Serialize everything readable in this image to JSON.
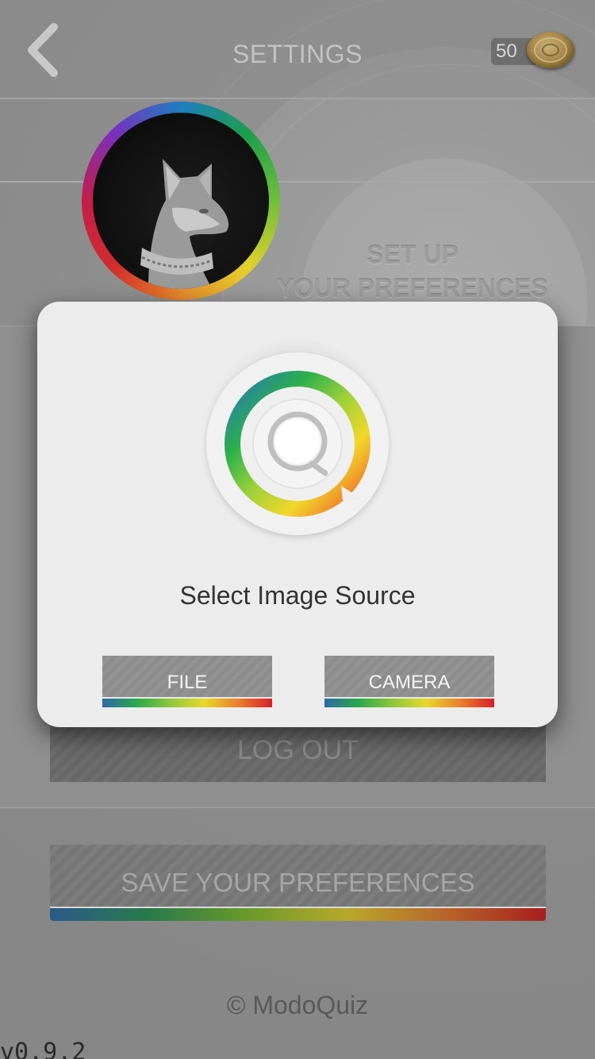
{
  "header": {
    "title": "SETTINGS",
    "coins": "50"
  },
  "profile": {
    "heading_line1": "SET UP",
    "heading_line2": "YOUR PREFERENCES"
  },
  "buttons": {
    "logout": "LOG OUT",
    "save": "SAVE YOUR PREFERENCES"
  },
  "footer": {
    "copyright": "© ModoQuiz",
    "version": "v0.9.2"
  },
  "modal": {
    "title": "Select Image Source",
    "file_label": "FILE",
    "camera_label": "CAMERA"
  },
  "icons": {
    "back": "chevron-left-icon",
    "coin": "coin-icon",
    "logo": "modoquiz-logo-icon"
  },
  "colors": {
    "accent_gradient": [
      "#1e7fbf",
      "#1b9e4a",
      "#6fbf3a",
      "#e3d02a",
      "#e88a2a",
      "#d22c2c"
    ],
    "modal_bg": "#ececec",
    "overlay_gray": "#8f8f8f"
  }
}
